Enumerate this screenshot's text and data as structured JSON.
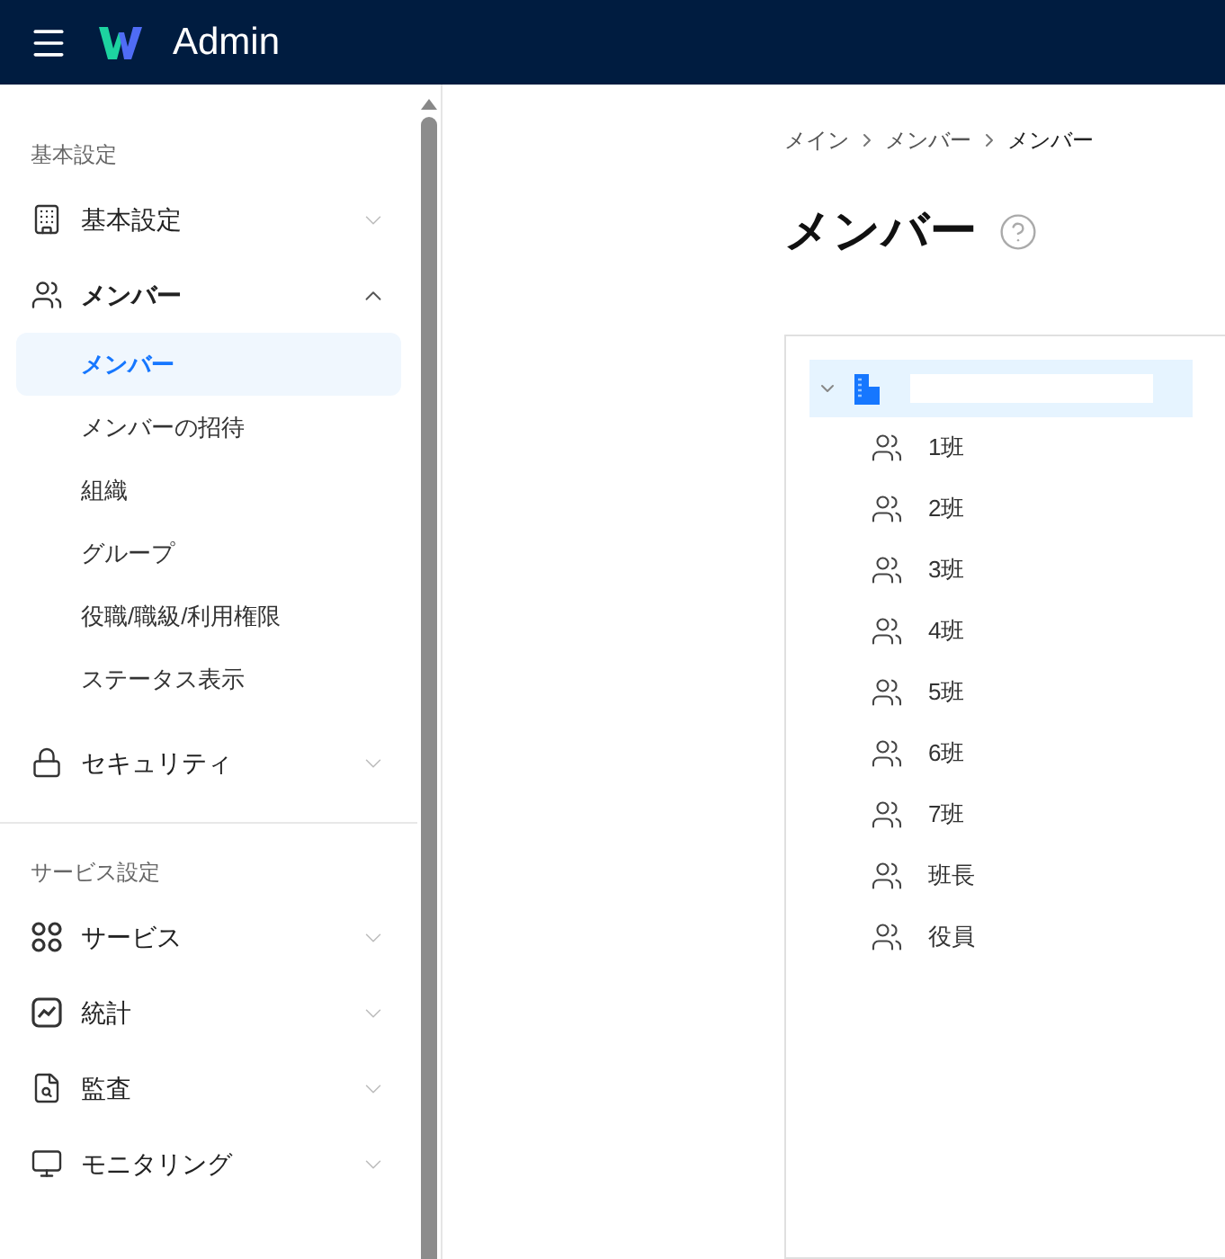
{
  "header": {
    "title": "Admin"
  },
  "sidebar": {
    "sections": [
      {
        "label": "基本設定",
        "items": [
          {
            "label": "基本設定",
            "expanded": false
          },
          {
            "label": "メンバー",
            "expanded": true,
            "children": [
              {
                "label": "メンバー",
                "selected": true
              },
              {
                "label": "メンバーの招待",
                "selected": false
              },
              {
                "label": "組織",
                "selected": false
              },
              {
                "label": "グループ",
                "selected": false
              },
              {
                "label": "役職/職級/利用権限",
                "selected": false
              },
              {
                "label": "ステータス表示",
                "selected": false
              }
            ]
          },
          {
            "label": "セキュリティ",
            "expanded": false
          }
        ]
      },
      {
        "label": "サービス設定",
        "items": [
          {
            "label": "サービス",
            "expanded": false
          },
          {
            "label": "統計",
            "expanded": false
          },
          {
            "label": "監査",
            "expanded": false
          },
          {
            "label": "モニタリング",
            "expanded": false
          }
        ]
      }
    ]
  },
  "breadcrumb": [
    "メイン",
    "メンバー",
    "メンバー"
  ],
  "page_title": "メンバー",
  "tree": {
    "root": {
      "expanded": true,
      "selected": true
    },
    "children": [
      {
        "label": "1班"
      },
      {
        "label": "2班"
      },
      {
        "label": "3班"
      },
      {
        "label": "4班"
      },
      {
        "label": "5班"
      },
      {
        "label": "6班"
      },
      {
        "label": "7班"
      },
      {
        "label": "班長"
      },
      {
        "label": "役員"
      }
    ]
  }
}
